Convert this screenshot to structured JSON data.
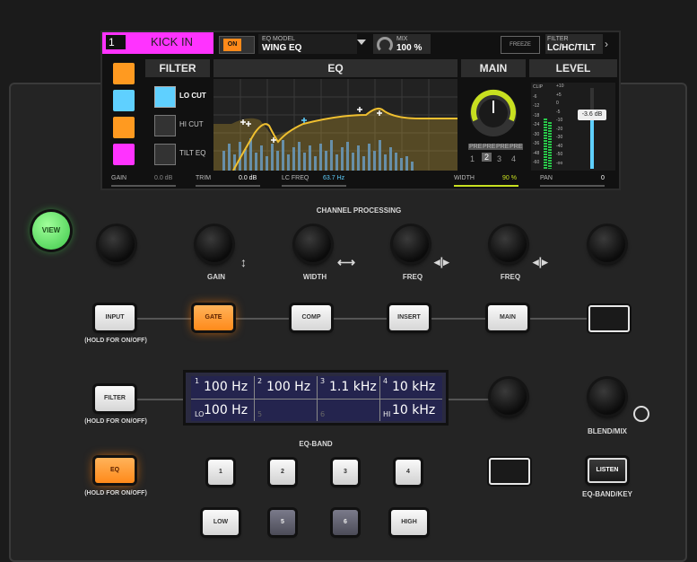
{
  "screen": {
    "channel_number": "1",
    "channel_name": "KICK IN",
    "on_label": "ON",
    "eq_model_caption": "EQ MODEL",
    "eq_model_value": "WING EQ",
    "mix_caption": "MIX",
    "mix_value": "100 %",
    "freeze_label": "FREEZE",
    "filter_caption": "FILTER",
    "filter_value": "LC/HC/TILT",
    "sections": {
      "filter": "FILTER",
      "eq": "EQ",
      "main": "MAIN",
      "level": "LEVEL"
    },
    "filter_options": [
      "LO CUT",
      "HI CUT",
      "TILT EQ"
    ],
    "pre_labels": [
      "PRE",
      "PRE",
      "PRE",
      "PRE"
    ],
    "main_buses": [
      "1",
      "2",
      "3",
      "4"
    ],
    "meter_scale_left": [
      "CLIP",
      "-6",
      "-12",
      "-18",
      "-24",
      "-30",
      "-36",
      "-48",
      "-60"
    ],
    "meter_scale_right": [
      "+10",
      "+5",
      "0",
      "-5",
      "-10",
      "-20",
      "-30",
      "-40",
      "-50",
      "-oo"
    ],
    "fader_value": "-3.6 dB",
    "bottom": {
      "gain_label": "GAIN",
      "gain_value": "0.0 dB",
      "trim_label": "TRIM",
      "trim_value": "0.0 dB",
      "lcfreq_label": "LC FREQ",
      "lcfreq_value": "63.7 Hz",
      "width_label": "WIDTH",
      "width_value": "90 %",
      "pan_label": "PAN",
      "pan_value": "0"
    }
  },
  "surface": {
    "view_label": "VIEW",
    "channel_processing": "CHANNEL PROCESSING",
    "knob_labels": [
      "GAIN",
      "WIDTH",
      "FREQ",
      "FREQ"
    ],
    "chain": [
      "INPUT",
      "GATE",
      "COMP",
      "INSERT",
      "MAIN"
    ],
    "hold_label": "(HOLD FOR ON/OFF)",
    "filter_label": "FILTER",
    "eq_label": "EQ",
    "eq_band_label": "EQ-BAND",
    "bands_top": [
      "1",
      "2",
      "3",
      "4"
    ],
    "bands_bottom": [
      "LOW",
      "5",
      "6",
      "HIGH"
    ],
    "listen_label": "LISTEN",
    "eq_band_key_label": "EQ-BAND/KEY",
    "blend_mix_label": "BLEND/MIX",
    "lcd": {
      "top": [
        {
          "n": "1",
          "v": "100 Hz"
        },
        {
          "n": "2",
          "v": "100 Hz"
        },
        {
          "n": "3",
          "v": "1.1 kHz"
        },
        {
          "n": "4",
          "v": "10 kHz"
        }
      ],
      "bottom": [
        {
          "n": "LO",
          "v": "100 Hz"
        },
        {
          "n": "5",
          "v": ""
        },
        {
          "n": "6",
          "v": ""
        },
        {
          "n": "HI",
          "v": "10 kHz"
        }
      ]
    }
  },
  "colors": {
    "accent_magenta": "#ff33ff",
    "accent_orange": "#ff8a1a",
    "accent_cyan": "#5fd0ff",
    "eq_curve": "#f0c030",
    "view_green": "#5fe06a"
  }
}
